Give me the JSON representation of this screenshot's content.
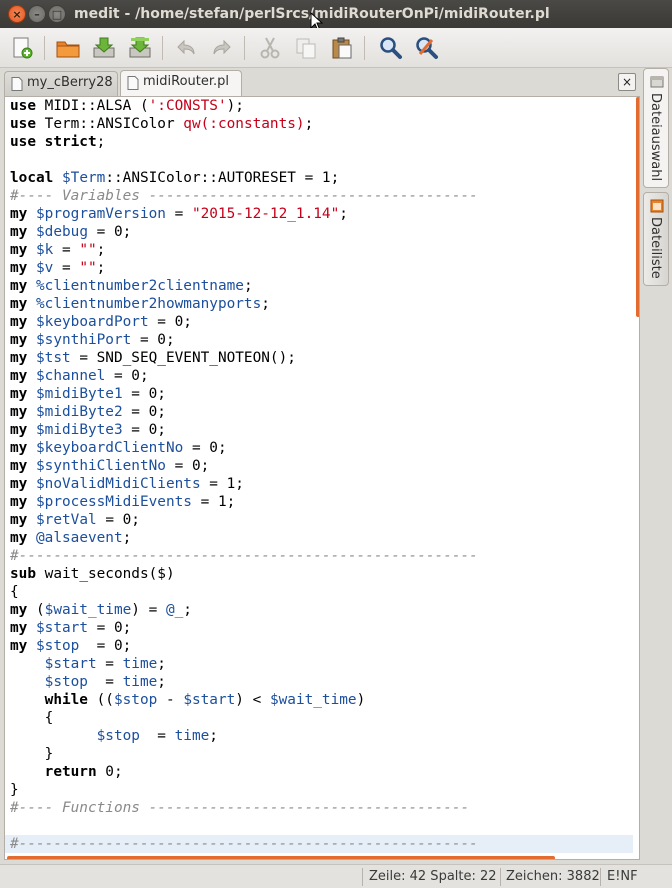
{
  "window": {
    "title": "medit - /home/stefan/perlSrcs/midiRouterOnPi/midiRouter.pl",
    "close_glyph": "×",
    "minimize_glyph": "–",
    "maximize_glyph": "□"
  },
  "toolbar": {
    "icons": [
      "new-file-icon",
      "open-folder-icon",
      "save-icon",
      "save-as-icon",
      "undo-icon",
      "redo-icon",
      "cut-icon",
      "copy-icon",
      "paste-icon",
      "find-icon",
      "find-replace-icon"
    ]
  },
  "tabs": [
    {
      "label": "my_cBerry28",
      "active": false
    },
    {
      "label": "midiRouter.pl",
      "active": true
    }
  ],
  "tab_close_glyph": "×",
  "side_panels": [
    {
      "label": "Dateiauswahl"
    },
    {
      "label": "Dateiliste"
    }
  ],
  "editor": {
    "current_line": 42,
    "lines": [
      [
        [
          "kw",
          "use"
        ],
        [
          "n",
          " MIDI::ALSA ("
        ],
        [
          "str",
          "':CONSTS'"
        ],
        [
          "n",
          ");"
        ]
      ],
      [
        [
          "kw",
          "use"
        ],
        [
          "n",
          " Term::ANSIColor "
        ],
        [
          "str",
          "qw(:constants)"
        ],
        [
          "n",
          ";"
        ]
      ],
      [
        [
          "kw",
          "use strict"
        ],
        [
          "n",
          ";"
        ]
      ],
      [
        [
          "n",
          ""
        ]
      ],
      [
        [
          "kw",
          "local"
        ],
        [
          "n",
          " "
        ],
        [
          "var",
          "$Term"
        ],
        [
          "n",
          "::ANSIColor::AUTORESET = 1;"
        ]
      ],
      [
        [
          "cmt",
          "#---- Variables --------------------------------------"
        ]
      ],
      [
        [
          "kw",
          "my"
        ],
        [
          "n",
          " "
        ],
        [
          "var",
          "$programVersion"
        ],
        [
          "n",
          " = "
        ],
        [
          "str",
          "\"2015-12-12_1.14\""
        ],
        [
          "n",
          ";"
        ]
      ],
      [
        [
          "kw",
          "my"
        ],
        [
          "n",
          " "
        ],
        [
          "var",
          "$debug"
        ],
        [
          "n",
          " = 0;"
        ]
      ],
      [
        [
          "kw",
          "my"
        ],
        [
          "n",
          " "
        ],
        [
          "var",
          "$k"
        ],
        [
          "n",
          " = "
        ],
        [
          "str",
          "\"\""
        ],
        [
          "n",
          ";"
        ]
      ],
      [
        [
          "kw",
          "my"
        ],
        [
          "n",
          " "
        ],
        [
          "var",
          "$v"
        ],
        [
          "n",
          " = "
        ],
        [
          "str",
          "\"\""
        ],
        [
          "n",
          ";"
        ]
      ],
      [
        [
          "kw",
          "my"
        ],
        [
          "n",
          " "
        ],
        [
          "var",
          "%clientnumber2clientname"
        ],
        [
          "n",
          ";"
        ]
      ],
      [
        [
          "kw",
          "my"
        ],
        [
          "n",
          " "
        ],
        [
          "var",
          "%clientnumber2howmanyports"
        ],
        [
          "n",
          ";"
        ]
      ],
      [
        [
          "kw",
          "my"
        ],
        [
          "n",
          " "
        ],
        [
          "var",
          "$keyboardPort"
        ],
        [
          "n",
          " = 0;"
        ]
      ],
      [
        [
          "kw",
          "my"
        ],
        [
          "n",
          " "
        ],
        [
          "var",
          "$synthiPort"
        ],
        [
          "n",
          " = 0;"
        ]
      ],
      [
        [
          "kw",
          "my"
        ],
        [
          "n",
          " "
        ],
        [
          "var",
          "$tst"
        ],
        [
          "n",
          " = SND_SEQ_EVENT_NOTEON();"
        ]
      ],
      [
        [
          "kw",
          "my"
        ],
        [
          "n",
          " "
        ],
        [
          "var",
          "$channel"
        ],
        [
          "n",
          " = 0;"
        ]
      ],
      [
        [
          "kw",
          "my"
        ],
        [
          "n",
          " "
        ],
        [
          "var",
          "$midiByte1"
        ],
        [
          "n",
          " = 0;"
        ]
      ],
      [
        [
          "kw",
          "my"
        ],
        [
          "n",
          " "
        ],
        [
          "var",
          "$midiByte2"
        ],
        [
          "n",
          " = 0;"
        ]
      ],
      [
        [
          "kw",
          "my"
        ],
        [
          "n",
          " "
        ],
        [
          "var",
          "$midiByte3"
        ],
        [
          "n",
          " = 0;"
        ]
      ],
      [
        [
          "kw",
          "my"
        ],
        [
          "n",
          " "
        ],
        [
          "var",
          "$keyboardClientNo"
        ],
        [
          "n",
          " = 0;"
        ]
      ],
      [
        [
          "kw",
          "my"
        ],
        [
          "n",
          " "
        ],
        [
          "var",
          "$synthiClientNo"
        ],
        [
          "n",
          " = 0;"
        ]
      ],
      [
        [
          "kw",
          "my"
        ],
        [
          "n",
          " "
        ],
        [
          "var",
          "$noValidMidiClients"
        ],
        [
          "n",
          " = 1;"
        ]
      ],
      [
        [
          "kw",
          "my"
        ],
        [
          "n",
          " "
        ],
        [
          "var",
          "$processMidiEvents"
        ],
        [
          "n",
          " = 1;"
        ]
      ],
      [
        [
          "kw",
          "my"
        ],
        [
          "n",
          " "
        ],
        [
          "var",
          "$retVal"
        ],
        [
          "n",
          " = 0;"
        ]
      ],
      [
        [
          "kw",
          "my"
        ],
        [
          "n",
          " "
        ],
        [
          "var",
          "@alsaevent"
        ],
        [
          "n",
          ";"
        ]
      ],
      [
        [
          "cmt",
          "#-----------------------------------------------------"
        ]
      ],
      [
        [
          "kw",
          "sub"
        ],
        [
          "n",
          " wait_seconds($)"
        ]
      ],
      [
        [
          "n",
          "{"
        ]
      ],
      [
        [
          "kw",
          "my"
        ],
        [
          "n",
          " ("
        ],
        [
          "var",
          "$wait_time"
        ],
        [
          "n",
          ") = "
        ],
        [
          "var",
          "@_"
        ],
        [
          "n",
          ";"
        ]
      ],
      [
        [
          "kw",
          "my"
        ],
        [
          "n",
          " "
        ],
        [
          "var",
          "$start"
        ],
        [
          "n",
          " = 0;"
        ]
      ],
      [
        [
          "kw",
          "my"
        ],
        [
          "n",
          " "
        ],
        [
          "var",
          "$stop"
        ],
        [
          "n",
          "  = 0;"
        ]
      ],
      [
        [
          "n",
          "    "
        ],
        [
          "var",
          "$start"
        ],
        [
          "n",
          " = "
        ],
        [
          "var",
          "time"
        ],
        [
          "n",
          ";"
        ]
      ],
      [
        [
          "n",
          "    "
        ],
        [
          "var",
          "$stop"
        ],
        [
          "n",
          "  = "
        ],
        [
          "var",
          "time"
        ],
        [
          "n",
          ";"
        ]
      ],
      [
        [
          "n",
          "    "
        ],
        [
          "kw",
          "while"
        ],
        [
          "n",
          " (("
        ],
        [
          "var",
          "$stop"
        ],
        [
          "n",
          " - "
        ],
        [
          "var",
          "$start"
        ],
        [
          "n",
          ") < "
        ],
        [
          "var",
          "$wait_time"
        ],
        [
          "n",
          ")"
        ]
      ],
      [
        [
          "n",
          "    {"
        ]
      ],
      [
        [
          "n",
          "          "
        ],
        [
          "var",
          "$stop"
        ],
        [
          "n",
          "  = "
        ],
        [
          "var",
          "time"
        ],
        [
          "n",
          ";"
        ]
      ],
      [
        [
          "n",
          "    }"
        ]
      ],
      [
        [
          "n",
          "    "
        ],
        [
          "kw",
          "return"
        ],
        [
          "n",
          " 0;"
        ]
      ],
      [
        [
          "n",
          "}"
        ]
      ],
      [
        [
          "cmt",
          "#---- Functions -------------------------------------"
        ]
      ],
      [
        [
          "n",
          ""
        ]
      ],
      [
        [
          "cmt",
          "#-----------------------------------------------------"
        ]
      ]
    ]
  },
  "status": {
    "position": "Zeile: 42 Spalte: 22",
    "chars": "Zeichen: 3882",
    "mode": "E!NF"
  },
  "colors": {
    "accent": "#e36b2f",
    "keyword": "#000000",
    "variable": "#1c4f9c",
    "string": "#c4001a",
    "comment": "#8a8a8a"
  }
}
